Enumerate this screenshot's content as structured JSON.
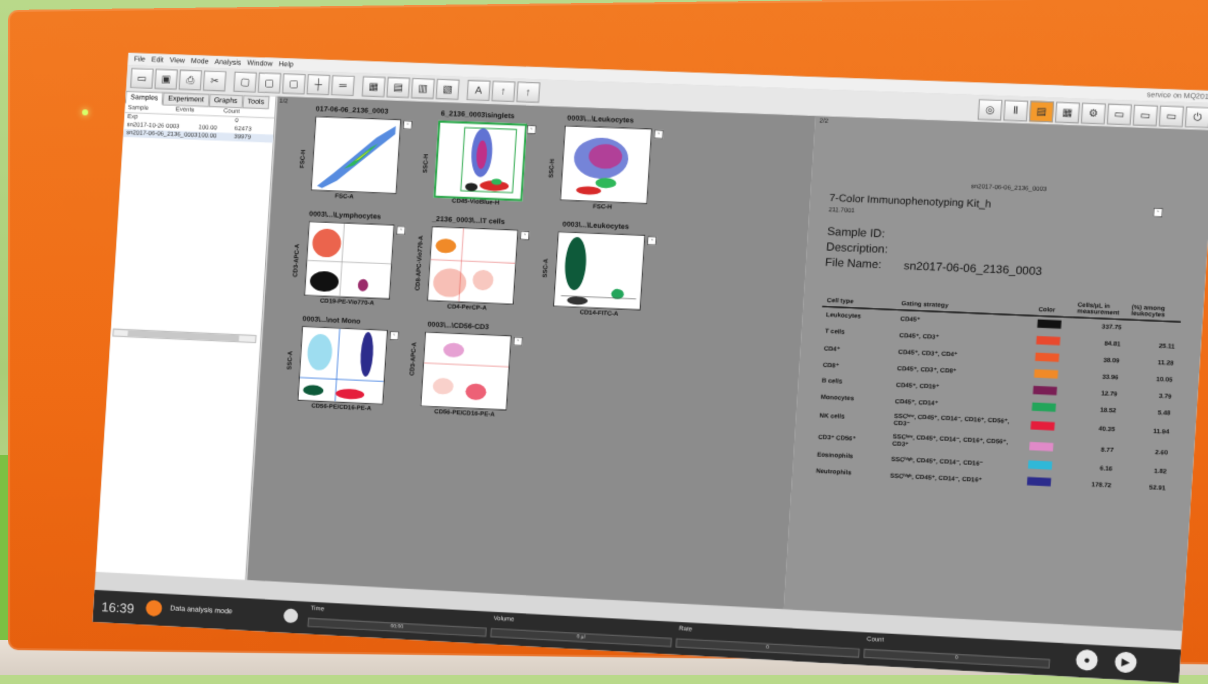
{
  "menu": [
    "File",
    "Edit",
    "View",
    "Mode",
    "Analysis",
    "Window",
    "Help"
  ],
  "user": "service on MQ2019",
  "left_tabs": [
    "Samples",
    "Experiment",
    "Graphs",
    "Tools"
  ],
  "tree": {
    "headers": [
      "Sample",
      "Events",
      "Count"
    ],
    "rows": [
      {
        "name": "Exp",
        "events": "",
        "count": "0"
      },
      {
        "name": "sn2017-10-26 0003",
        "events": "100.00",
        "count": "62473"
      },
      {
        "name": "sn2017-06-06_2136_0003",
        "events": "100.00",
        "count": "39979"
      }
    ]
  },
  "plot_page": "1/2",
  "report_page": "2/2",
  "plots": [
    {
      "title": "017-06-06_2136_0003",
      "x": "FSC-A",
      "y": "FSC-H"
    },
    {
      "title": "6_2136_0003\\singlets",
      "x": "CD45-VioBlue-H",
      "y": "SSC-H"
    },
    {
      "title": "0003\\...\\Leukocytes",
      "x": "FSC-H",
      "y": "SSC-H"
    },
    {
      "title": "0003\\...\\Lymphocytes",
      "x": "CD19-PE-Vio770-A",
      "y": "CD3-APC-A"
    },
    {
      "title": "_2136_0003\\...\\T cells",
      "x": "CD4-PerCP-A",
      "y": "CD8-APC-Vio770-A"
    },
    {
      "title": "0003\\...\\Leukocytes",
      "x": "CD14-FITC-A",
      "y": "SSC-A"
    },
    {
      "title": "0003\\...\\not Mono",
      "x": "CD56-PE/CD16-PE-A",
      "y": "SSC-A"
    },
    {
      "title": "0003\\...\\CD56-CD3",
      "x": "CD56-PE/CD16-PE-A",
      "y": "CD3-APC-A"
    }
  ],
  "report": {
    "file_top": "sn2017-06-06_2136_0003",
    "title": "7-Color Immunophenotyping Kit_h",
    "sub": "211.7001",
    "sample_id_label": "Sample ID:",
    "description_label": "Description:",
    "file_name_label": "File Name:",
    "file_name": "sn2017-06-06_2136_0003",
    "columns": [
      "Cell type",
      "Gating strategy",
      "Color",
      "Cells/µL in measurement",
      "(%) among leukocytes"
    ],
    "rows": [
      {
        "cell": "Leukocytes",
        "gate": "CD45⁺",
        "color": "#111111",
        "cells": "337.75",
        "pct": ""
      },
      {
        "cell": "T cells",
        "gate": "CD45⁺, CD3⁺",
        "color": "#e8492e",
        "cells": "84.81",
        "pct": "25.11"
      },
      {
        "cell": "CD4⁺",
        "gate": "CD45⁺, CD3⁺, CD4⁺",
        "color": "#ee5a2a",
        "cells": "38.09",
        "pct": "11.28"
      },
      {
        "cell": "CD8⁺",
        "gate": "CD45⁺, CD3⁺, CD8⁺",
        "color": "#f08a28",
        "cells": "33.96",
        "pct": "10.05"
      },
      {
        "cell": "B cells",
        "gate": "CD45⁺, CD19⁺",
        "color": "#7a1f55",
        "cells": "12.79",
        "pct": "3.79"
      },
      {
        "cell": "Monocytes",
        "gate": "CD45⁺, CD14⁺",
        "color": "#22a55a",
        "cells": "18.52",
        "pct": "5.48"
      },
      {
        "cell": "NK cells",
        "gate": "SSCˡᵒʷ, CD45⁺, CD14⁻, CD16⁺, CD56⁺, CD3⁻",
        "color": "#e51e3c",
        "cells": "40.35",
        "pct": "11.94"
      },
      {
        "cell": "CD3⁺ CD56⁺",
        "gate": "SSCˡᵒʷ, CD45⁺, CD14⁻, CD16⁺, CD56⁺, CD3⁺",
        "color": "#e08ac8",
        "cells": "8.77",
        "pct": "2.60"
      },
      {
        "cell": "Eosinophils",
        "gate": "SSCʰⁱᵍʰ, CD45⁺, CD14⁻, CD16⁻",
        "color": "#2fb8d8",
        "cells": "6.16",
        "pct": "1.82"
      },
      {
        "cell": "Neutrophils",
        "gate": "SSCʰⁱᵍʰ, CD45⁺, CD14⁻, CD16⁺",
        "color": "#2c2c8c",
        "cells": "178.72",
        "pct": "52.91"
      }
    ]
  },
  "status": {
    "time": "16:39",
    "mode": "Data analysis mode",
    "labels": [
      "Time",
      "Volume",
      "Rate",
      "Count"
    ],
    "values": [
      "00:00",
      "0 µl",
      "0",
      "0"
    ]
  }
}
